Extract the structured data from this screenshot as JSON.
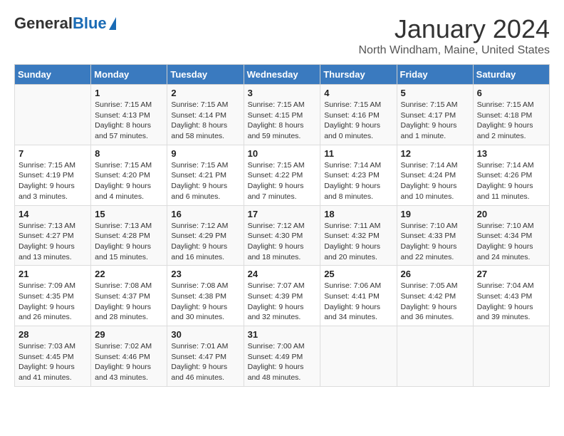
{
  "header": {
    "logo_general": "General",
    "logo_blue": "Blue",
    "month_title": "January 2024",
    "subtitle": "North Windham, Maine, United States"
  },
  "days_of_week": [
    "Sunday",
    "Monday",
    "Tuesday",
    "Wednesday",
    "Thursday",
    "Friday",
    "Saturday"
  ],
  "weeks": [
    [
      {
        "day": "",
        "info": ""
      },
      {
        "day": "1",
        "info": "Sunrise: 7:15 AM\nSunset: 4:13 PM\nDaylight: 8 hours\nand 57 minutes."
      },
      {
        "day": "2",
        "info": "Sunrise: 7:15 AM\nSunset: 4:14 PM\nDaylight: 8 hours\nand 58 minutes."
      },
      {
        "day": "3",
        "info": "Sunrise: 7:15 AM\nSunset: 4:15 PM\nDaylight: 8 hours\nand 59 minutes."
      },
      {
        "day": "4",
        "info": "Sunrise: 7:15 AM\nSunset: 4:16 PM\nDaylight: 9 hours\nand 0 minutes."
      },
      {
        "day": "5",
        "info": "Sunrise: 7:15 AM\nSunset: 4:17 PM\nDaylight: 9 hours\nand 1 minute."
      },
      {
        "day": "6",
        "info": "Sunrise: 7:15 AM\nSunset: 4:18 PM\nDaylight: 9 hours\nand 2 minutes."
      }
    ],
    [
      {
        "day": "7",
        "info": "Sunrise: 7:15 AM\nSunset: 4:19 PM\nDaylight: 9 hours\nand 3 minutes."
      },
      {
        "day": "8",
        "info": "Sunrise: 7:15 AM\nSunset: 4:20 PM\nDaylight: 9 hours\nand 4 minutes."
      },
      {
        "day": "9",
        "info": "Sunrise: 7:15 AM\nSunset: 4:21 PM\nDaylight: 9 hours\nand 6 minutes."
      },
      {
        "day": "10",
        "info": "Sunrise: 7:15 AM\nSunset: 4:22 PM\nDaylight: 9 hours\nand 7 minutes."
      },
      {
        "day": "11",
        "info": "Sunrise: 7:14 AM\nSunset: 4:23 PM\nDaylight: 9 hours\nand 8 minutes."
      },
      {
        "day": "12",
        "info": "Sunrise: 7:14 AM\nSunset: 4:24 PM\nDaylight: 9 hours\nand 10 minutes."
      },
      {
        "day": "13",
        "info": "Sunrise: 7:14 AM\nSunset: 4:26 PM\nDaylight: 9 hours\nand 11 minutes."
      }
    ],
    [
      {
        "day": "14",
        "info": "Sunrise: 7:13 AM\nSunset: 4:27 PM\nDaylight: 9 hours\nand 13 minutes."
      },
      {
        "day": "15",
        "info": "Sunrise: 7:13 AM\nSunset: 4:28 PM\nDaylight: 9 hours\nand 15 minutes."
      },
      {
        "day": "16",
        "info": "Sunrise: 7:12 AM\nSunset: 4:29 PM\nDaylight: 9 hours\nand 16 minutes."
      },
      {
        "day": "17",
        "info": "Sunrise: 7:12 AM\nSunset: 4:30 PM\nDaylight: 9 hours\nand 18 minutes."
      },
      {
        "day": "18",
        "info": "Sunrise: 7:11 AM\nSunset: 4:32 PM\nDaylight: 9 hours\nand 20 minutes."
      },
      {
        "day": "19",
        "info": "Sunrise: 7:10 AM\nSunset: 4:33 PM\nDaylight: 9 hours\nand 22 minutes."
      },
      {
        "day": "20",
        "info": "Sunrise: 7:10 AM\nSunset: 4:34 PM\nDaylight: 9 hours\nand 24 minutes."
      }
    ],
    [
      {
        "day": "21",
        "info": "Sunrise: 7:09 AM\nSunset: 4:35 PM\nDaylight: 9 hours\nand 26 minutes."
      },
      {
        "day": "22",
        "info": "Sunrise: 7:08 AM\nSunset: 4:37 PM\nDaylight: 9 hours\nand 28 minutes."
      },
      {
        "day": "23",
        "info": "Sunrise: 7:08 AM\nSunset: 4:38 PM\nDaylight: 9 hours\nand 30 minutes."
      },
      {
        "day": "24",
        "info": "Sunrise: 7:07 AM\nSunset: 4:39 PM\nDaylight: 9 hours\nand 32 minutes."
      },
      {
        "day": "25",
        "info": "Sunrise: 7:06 AM\nSunset: 4:41 PM\nDaylight: 9 hours\nand 34 minutes."
      },
      {
        "day": "26",
        "info": "Sunrise: 7:05 AM\nSunset: 4:42 PM\nDaylight: 9 hours\nand 36 minutes."
      },
      {
        "day": "27",
        "info": "Sunrise: 7:04 AM\nSunset: 4:43 PM\nDaylight: 9 hours\nand 39 minutes."
      }
    ],
    [
      {
        "day": "28",
        "info": "Sunrise: 7:03 AM\nSunset: 4:45 PM\nDaylight: 9 hours\nand 41 minutes."
      },
      {
        "day": "29",
        "info": "Sunrise: 7:02 AM\nSunset: 4:46 PM\nDaylight: 9 hours\nand 43 minutes."
      },
      {
        "day": "30",
        "info": "Sunrise: 7:01 AM\nSunset: 4:47 PM\nDaylight: 9 hours\nand 46 minutes."
      },
      {
        "day": "31",
        "info": "Sunrise: 7:00 AM\nSunset: 4:49 PM\nDaylight: 9 hours\nand 48 minutes."
      },
      {
        "day": "",
        "info": ""
      },
      {
        "day": "",
        "info": ""
      },
      {
        "day": "",
        "info": ""
      }
    ]
  ]
}
